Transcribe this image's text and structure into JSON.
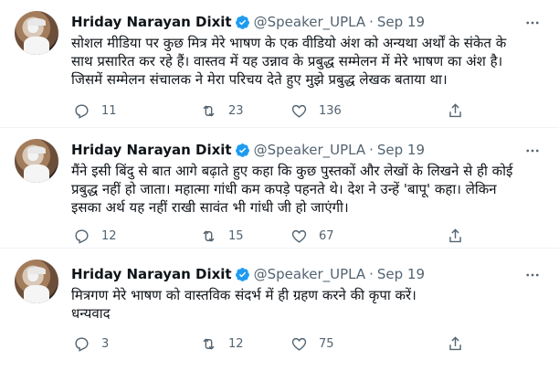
{
  "tweets": [
    {
      "name": "Hriday Narayan Dixit",
      "handle": "@Speaker_UPLA",
      "separator": "·",
      "date": "Sep 19",
      "lines": [
        "सोशल मीडिया पर कुछ मित्र मेरे भाषण के एक वीडियो अंश को अन्यथा अर्थों के संकेत के",
        "साथ प्रसारित कर रहे हैं। वास्तव में यह उन्नाव के प्रबुद्ध सम्मेलन में मेरे भाषण का अंश है।",
        "जिसमें सम्मेलन संचालक ने मेरा परिचय देते हुए मुझे प्रबुद्ध लेखक बताया था।"
      ],
      "replies": "11",
      "retweets": "23",
      "likes": "136"
    },
    {
      "name": "Hriday Narayan Dixit",
      "handle": "@Speaker_UPLA",
      "separator": "·",
      "date": "Sep 19",
      "lines": [
        "मैंने इसी बिंदु से बात आगे बढ़ाते हुए कहा कि कुछ पुस्तकों और लेखों के लिखने से ही कोई",
        "प्रबुद्ध नहीं हो जाता। महात्मा गांधी कम कपड़े पहनते थे। देश ने उन्हें 'बापू' कहा। लेकिन",
        "इसका अर्थ यह नहीं राखी सावंत भी गांधी जी हो जाएंगी।"
      ],
      "replies": "12",
      "retweets": "15",
      "likes": "67"
    },
    {
      "name": "Hriday Narayan Dixit",
      "handle": "@Speaker_UPLA",
      "separator": "·",
      "date": "Sep 19",
      "lines": [
        "मित्रगण मेरे भाषण को वास्तविक संदर्भ में ही ग्रहण करने की कृपा करें।",
        "धन्यवाद"
      ],
      "replies": "3",
      "retweets": "12",
      "likes": "75"
    }
  ],
  "icons": {
    "verified": "verified-badge-icon",
    "more": "more-horizontal-icon",
    "reply": "reply-icon",
    "retweet": "retweet-icon",
    "like": "heart-icon",
    "share": "share-icon"
  },
  "colors": {
    "text": "#0f1419",
    "secondary": "#536471",
    "verified": "#1d9bf0",
    "divider": "#eff3f4"
  }
}
